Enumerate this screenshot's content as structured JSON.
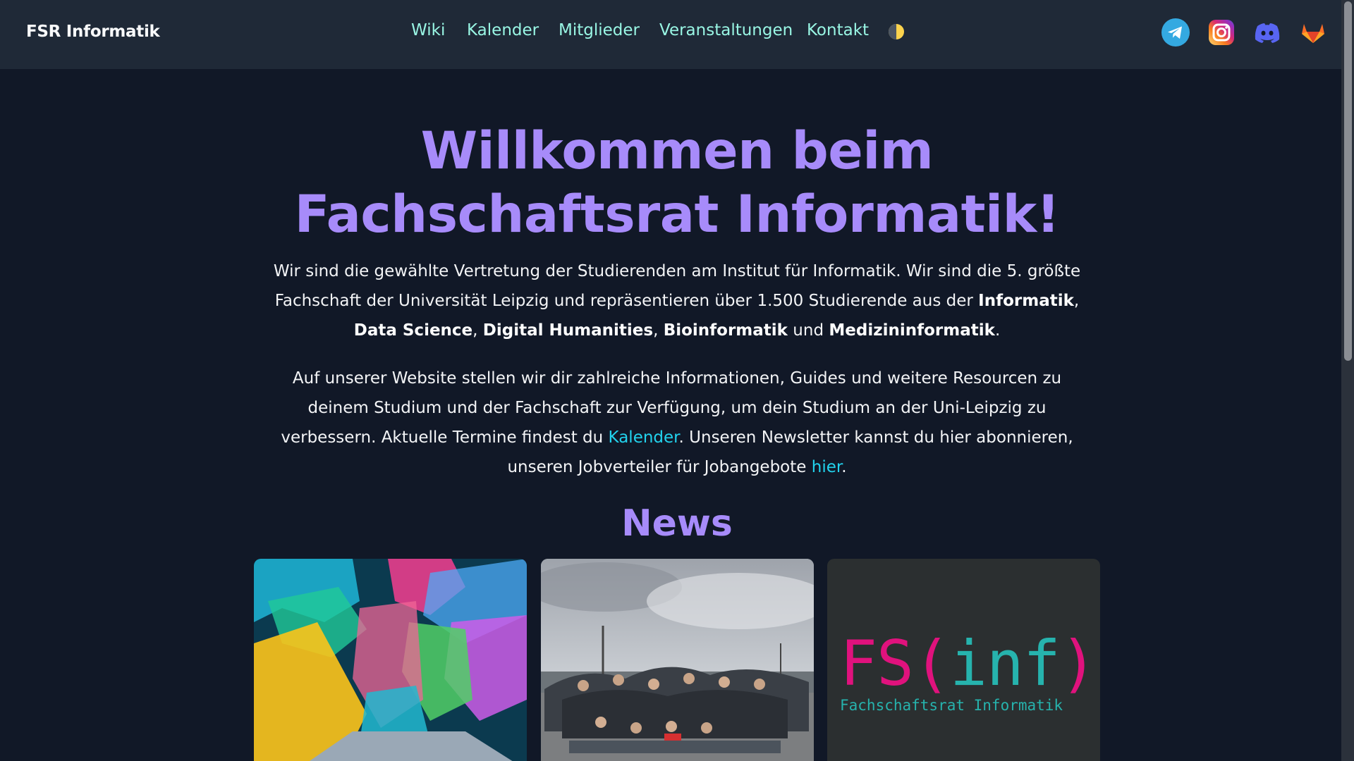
{
  "brand": "FSR Informatik",
  "nav": {
    "items": [
      {
        "label": "Wiki"
      },
      {
        "label": "Kalender"
      },
      {
        "label": "Mitglieder"
      },
      {
        "label": "Veranstaltungen"
      },
      {
        "label": "Kontakt"
      }
    ],
    "theme_toggle_icon": "half-moon-icon"
  },
  "socials": [
    {
      "icon": "telegram-icon",
      "color": "#34a9e1"
    },
    {
      "icon": "instagram-icon",
      "color": "#d62976"
    },
    {
      "icon": "discord-icon",
      "color": "#5865f2"
    },
    {
      "icon": "gitlab-icon",
      "color": "#fc6d26"
    }
  ],
  "hero": {
    "title_line1": "Willkommen beim",
    "title_line2": "Fachschaftsrat Informatik!",
    "p1": {
      "intro": "Wir sind die gewählte Vertretung der Studierenden am Institut für Informatik. Wir sind die 5. größte Fachschaft der Universität Leipzig und repräsentieren über 1.500 Studierende aus der ",
      "course1": "Informatik",
      "sep1": ", ",
      "course2": "Data Science",
      "sep2": ", ",
      "course3": "Digital Humanities",
      "sep3": ", ",
      "course4": "Bioinformatik",
      "and": " und ",
      "course5": "Medizininformatik",
      "end": "."
    },
    "p2": {
      "text1": "Auf unserer Website stellen wir dir zahlreiche Informationen, Guides und weitere Resourcen zu deinem Studium und der Fachschaft zur Verfügung, um dein Studium an der Uni-Leipzig zu verbessern. Aktuelle Termine findest du ",
      "link1": "Kalender",
      "text2": ". Unseren Newsletter kannst du hier abonnieren, unseren Jobverteiler für Jobangebote ",
      "link2": "hier",
      "text3": "."
    }
  },
  "news": {
    "title": "News",
    "cards": [
      {
        "image": "voting-hands-illustration"
      },
      {
        "image": "group-photo"
      },
      {
        "logo_fs": "FS(",
        "logo_inf": "inf",
        "logo_close": ")",
        "logo_sub": "Fachschaftsrat Informatik"
      }
    ]
  },
  "colors": {
    "header_bg": "#1f2937",
    "page_bg": "#111827",
    "accent_purple": "#a78bfa",
    "nav_link": "#99f6e4",
    "link": "#22d3ee"
  }
}
